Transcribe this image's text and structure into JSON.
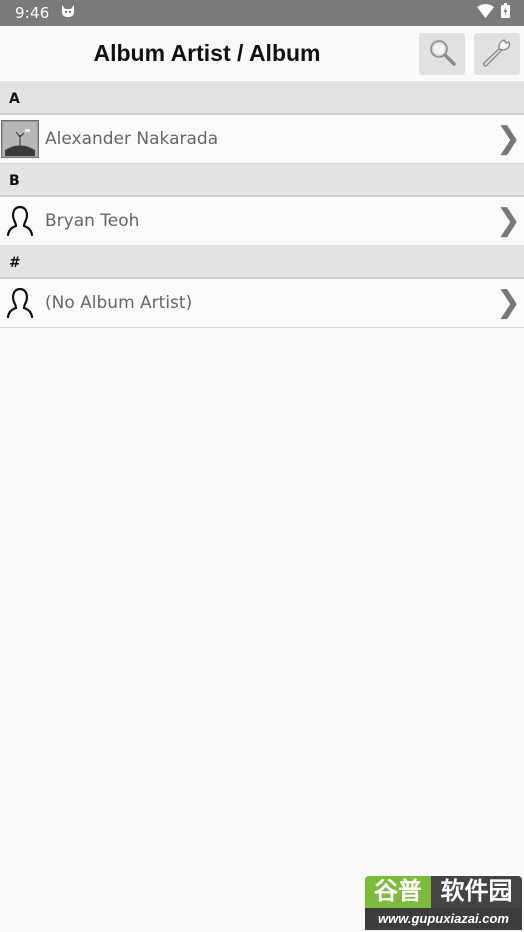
{
  "status_bar": {
    "time": "9:46"
  },
  "header": {
    "title": "Album Artist / Album"
  },
  "sections": [
    {
      "letter": "A",
      "items": [
        {
          "name": "Alexander Nakarada",
          "icon": "album-art-thumbnail"
        }
      ]
    },
    {
      "letter": "B",
      "items": [
        {
          "name": "Bryan Teoh",
          "icon": "person-icon"
        }
      ]
    },
    {
      "letter": "#",
      "items": [
        {
          "name": "(No Album Artist)",
          "icon": "person-icon"
        }
      ]
    }
  ],
  "chevron": "❯",
  "watermark": {
    "brand": "谷普软件园",
    "url": "www.gupuxiazai.com"
  }
}
